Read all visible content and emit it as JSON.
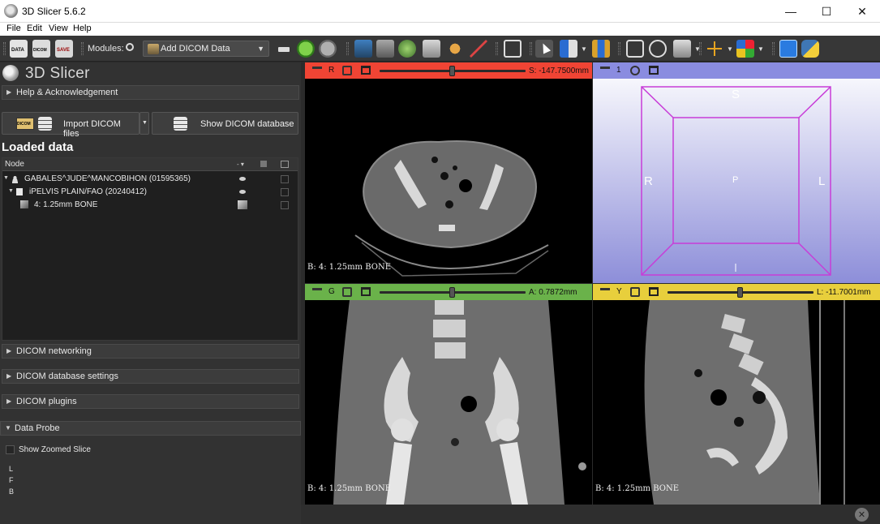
{
  "window": {
    "title": "3D Slicer 5.6.2",
    "minimize": "—",
    "maximize": "☐",
    "close": "✕"
  },
  "menu": [
    "File",
    "Edit",
    "View",
    "Help"
  ],
  "toolbar": {
    "modules_label": "Modules:",
    "module_selected": "Add DICOM Data",
    "dicom_label": "DICOM",
    "data_label": "DATA",
    "save_label": "SAVE"
  },
  "left": {
    "app_name": "3D Slicer",
    "help_section": "Help & Acknowledgement",
    "import_button": "Import DICOM files",
    "show_db_button": "Show DICOM database",
    "loaded_data_title": "Loaded data",
    "tree_header": "Node",
    "tree_rows": [
      {
        "label": "GABALES^JUDE^MANCOBIHON (01595365)"
      },
      {
        "label": "iPELVIS PLAIN/FAO (20240412)"
      },
      {
        "label": "4: 1.25mm BONE"
      }
    ],
    "sections": [
      "DICOM networking",
      "DICOM database settings",
      "DICOM plugins",
      "Data Probe"
    ],
    "show_zoomed_slice": "Show Zoomed Slice",
    "probe_letters": [
      "L",
      "F",
      "B"
    ]
  },
  "views": {
    "red": {
      "letter": "R",
      "offset": "S: -147.7500mm",
      "slider_fraction": 0.5,
      "label": "B: 4: 1.25mm BONE",
      "color": "#f04434"
    },
    "threed": {
      "number": "1",
      "color": "#8a8ce0",
      "orientations": {
        "top": "S",
        "left": "R",
        "right": "L",
        "center": "P"
      }
    },
    "green": {
      "letter": "G",
      "offset": "A: 0.7872mm",
      "slider_fraction": 0.5,
      "label": "B: 4: 1.25mm BONE",
      "color": "#6ab24a"
    },
    "yellow": {
      "letter": "Y",
      "offset": "L: -11.7001mm",
      "slider_fraction": 0.5,
      "label": "B: 4: 1.25mm BONE",
      "color": "#e8cf3c"
    }
  },
  "colors": {
    "accent_red": "#f04434",
    "accent_green": "#6ab24a",
    "accent_yellow": "#e8cf3c",
    "accent_3d": "#8a8ce0",
    "bbox_magenta": "#c83cd8"
  }
}
